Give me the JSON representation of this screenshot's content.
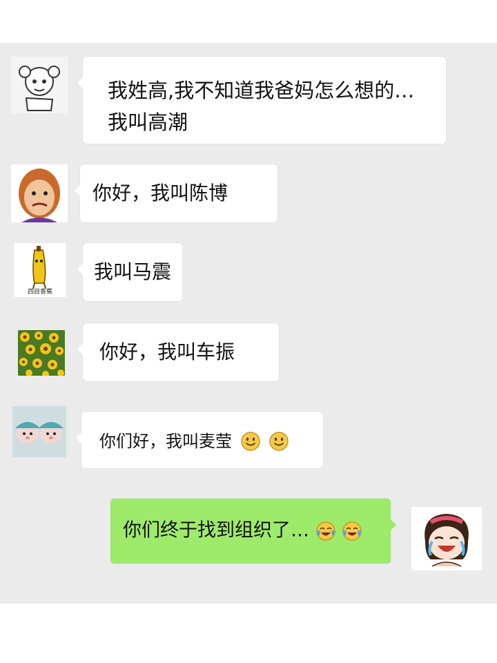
{
  "chat": {
    "messages": [
      {
        "id": 1,
        "side": "left",
        "avatar_icon": "sketch-girl-avatar-icon",
        "lines": [
          "我姓高,我不知道我爸妈怎么想的…",
          "我叫高潮"
        ]
      },
      {
        "id": 2,
        "side": "left",
        "avatar_icon": "cartoon-man-avatar-icon",
        "text": "你好，我叫陈博"
      },
      {
        "id": 3,
        "side": "left",
        "avatar_icon": "banana-avatar-icon",
        "avatar_caption": "四目香蕉",
        "text": "我叫马震"
      },
      {
        "id": 4,
        "side": "left",
        "avatar_icon": "sunflower-avatar-icon",
        "text": "你好，我叫车振"
      },
      {
        "id": 5,
        "side": "left",
        "avatar_icon": "hamsters-avatar-icon",
        "text": "你们好，我叫麦莹",
        "emoji": [
          "smile-emoji-icon",
          "smile-emoji-icon"
        ]
      },
      {
        "id": 6,
        "side": "right",
        "avatar_icon": "crying-laughing-girl-avatar-icon",
        "text": "你们终于找到组织了…",
        "emoji": [
          "tears-of-joy-emoji-icon",
          "tears-of-joy-emoji-icon"
        ]
      }
    ]
  },
  "colors": {
    "chat_bg": "#ebebeb",
    "bubble_left": "#ffffff",
    "bubble_right": "#9eea6a",
    "emoji_yellow": "#f7c948"
  }
}
